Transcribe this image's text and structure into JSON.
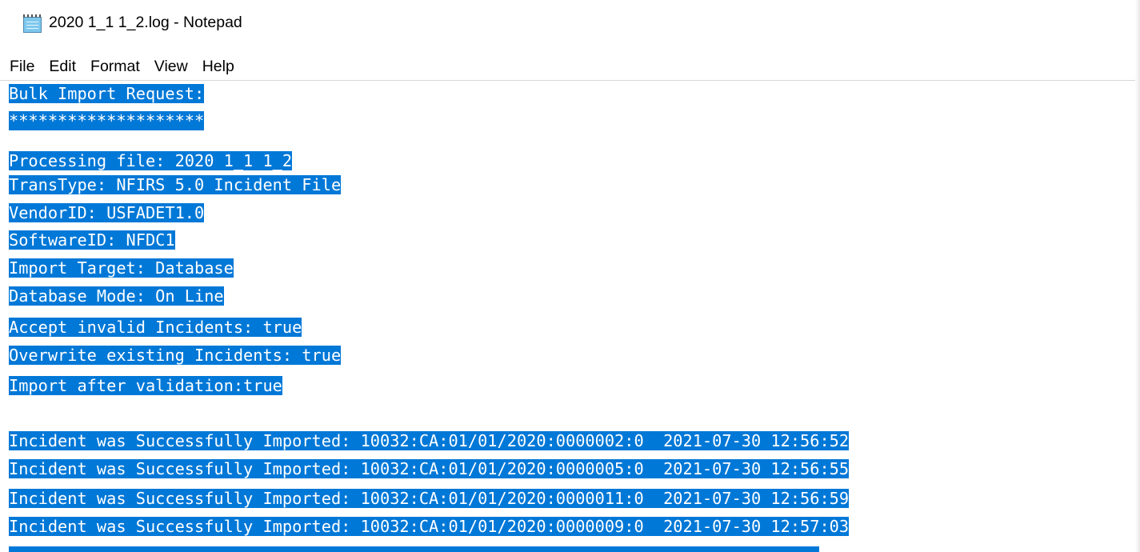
{
  "window": {
    "title": "2020 1_1 1_2.log - Notepad",
    "app_icon": "notepad-icon"
  },
  "menu": [
    "File",
    "Edit",
    "Format",
    "View",
    "Help"
  ],
  "colors": {
    "selection_background": "#0078d7",
    "selection_text": "#ffffff",
    "text": "#000000"
  },
  "document": {
    "lines": [
      "Bulk Import Request:",
      "********************",
      "Processing file: 2020 1_1 1_2",
      "TransType: NFIRS 5.0 Incident File",
      "VendorID: USFADET1.0",
      "SoftwareID: NFDC1",
      "Import Target: Database",
      "Database Mode: On Line",
      "Accept invalid Incidents: true",
      "Overwrite existing Incidents: true",
      "Import after validation:true",
      "",
      "Incident was Successfully Imported: 10032:CA:01/01/2020:0000002:0  2021-07-30 12:56:52",
      "Incident was Successfully Imported: 10032:CA:01/01/2020:0000005:0  2021-07-30 12:56:55",
      "Incident was Successfully Imported: 10032:CA:01/01/2020:0000011:0  2021-07-30 12:56:59",
      "Incident was Successfully Imported: 10032:CA:01/01/2020:0000009:0  2021-07-30 12:57:03"
    ]
  }
}
